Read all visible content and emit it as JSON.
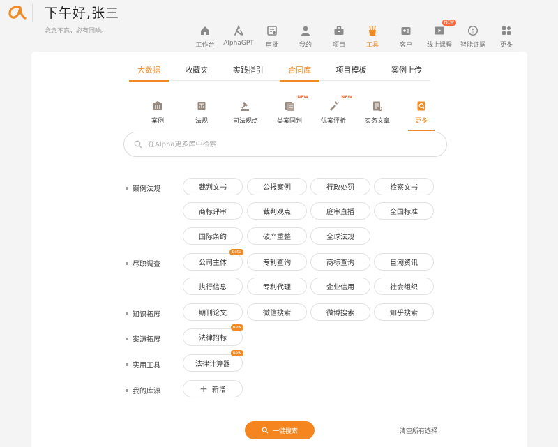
{
  "header": {
    "greeting": "下午好,张三",
    "motto": "念念不忘，必有回响。",
    "nav": [
      {
        "label": "工作台",
        "icon": "home-icon"
      },
      {
        "label": "AlphaGPT",
        "icon": "alphagpt-icon"
      },
      {
        "label": "审批",
        "icon": "approval-icon"
      },
      {
        "label": "我的",
        "icon": "user-icon"
      },
      {
        "label": "项目",
        "icon": "briefcase-icon"
      },
      {
        "label": "工具",
        "icon": "tools-icon"
      },
      {
        "label": "客户",
        "icon": "client-card-icon"
      },
      {
        "label": "线上课程",
        "icon": "online-course-icon",
        "badge": "NEW"
      },
      {
        "label": "智能证据",
        "icon": "smart-evidence-icon"
      },
      {
        "label": "更多",
        "icon": "grid-more-icon"
      }
    ],
    "active_nav": "工具"
  },
  "tabs": [
    "大数据",
    "收藏夹",
    "实践指引",
    "合同库",
    "项目模板",
    "案例上传"
  ],
  "subtabs": [
    {
      "label": "案例",
      "icon": "case-icon"
    },
    {
      "label": "法规",
      "icon": "regulation-icon"
    },
    {
      "label": "司法观点",
      "icon": "gavel-icon"
    },
    {
      "label": "类案同判",
      "icon": "similar-case-icon",
      "badge": "NEW"
    },
    {
      "label": "优案评析",
      "icon": "case-review-icon",
      "badge": "NEW"
    },
    {
      "label": "实务文章",
      "icon": "article-icon"
    },
    {
      "label": "更多",
      "icon": "more-doc-icon"
    }
  ],
  "search": {
    "placeholder": "在Alpha更多库中检索"
  },
  "categories": [
    {
      "label": "案例法规",
      "chips": [
        {
          "label": "裁判文书"
        },
        {
          "label": "公报案例"
        },
        {
          "label": "行政处罚"
        },
        {
          "label": "检察文书"
        },
        {
          "label": "商标评审"
        },
        {
          "label": "裁判观点"
        },
        {
          "label": "庭审直播"
        },
        {
          "label": "全国标准"
        },
        {
          "label": "国际条约"
        },
        {
          "label": "破产重整"
        },
        {
          "label": "全球法规"
        }
      ]
    },
    {
      "label": "尽职调查",
      "chips": [
        {
          "label": "公司主体",
          "badge": "beta"
        },
        {
          "label": "专利查询"
        },
        {
          "label": "商标查询"
        },
        {
          "label": "巨潮资讯"
        },
        {
          "label": "执行信息"
        },
        {
          "label": "专利代理"
        },
        {
          "label": "企业信用"
        },
        {
          "label": "社会组织"
        }
      ]
    },
    {
      "label": "知识拓展",
      "chips": [
        {
          "label": "期刊论文"
        },
        {
          "label": "微信搜索"
        },
        {
          "label": "微博搜索"
        },
        {
          "label": "知乎搜索"
        }
      ]
    },
    {
      "label": "案源拓展",
      "chips": [
        {
          "label": "法律招标",
          "badge": "new"
        }
      ]
    },
    {
      "label": "实用工具",
      "chips": [
        {
          "label": "法律计算器",
          "badge": "new"
        }
      ]
    },
    {
      "label": "我的库源",
      "chips": [
        {
          "label": "新增"
        }
      ]
    }
  ],
  "actions": {
    "search_button": "一键搜索",
    "clear": "清空所有选择"
  },
  "colors": {
    "accent": "#f08a24",
    "badge": "#ff6a3d"
  }
}
